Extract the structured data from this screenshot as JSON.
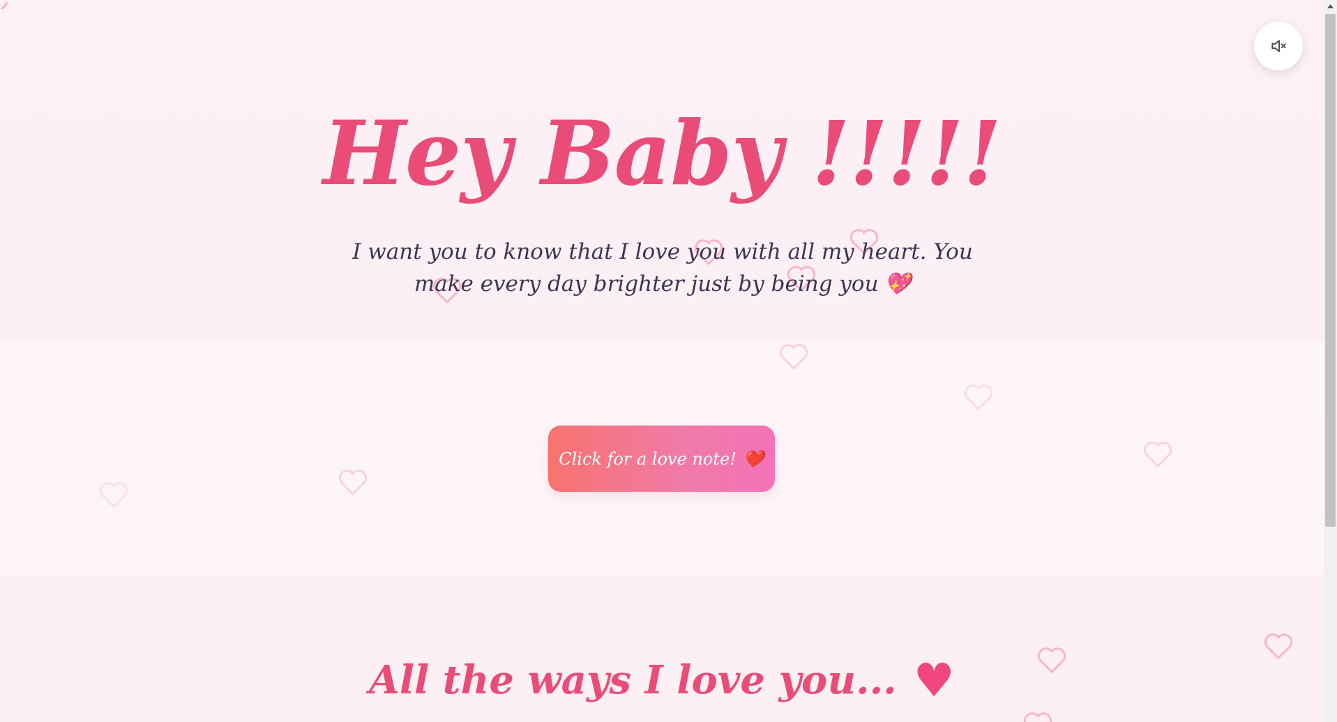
{
  "hero": {
    "title": "Hey Baby !!!!!",
    "message": "I want you to know that I love you with all my heart. You make every day brighter just by being you",
    "message_emoji": "💖"
  },
  "love_note_button": {
    "label": "Click for a love note!",
    "emoji": "❤️"
  },
  "ways": {
    "title": "All the ways I love you...",
    "heart": "♥"
  },
  "controls": {
    "mute_icon": "speaker-muted-icon"
  },
  "colors": {
    "accent_pink": "#ea4c78",
    "button_gradient_start": "#f7736e",
    "button_gradient_end": "#f472b6",
    "text_dark": "#3c3550",
    "background": "#fdf0f5"
  }
}
